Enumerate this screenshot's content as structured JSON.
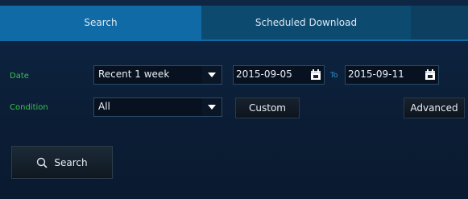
{
  "tabs": {
    "search": "Search",
    "scheduled": "Scheduled Download"
  },
  "date": {
    "label": "Date",
    "range_value": "Recent 1 week",
    "from": "2015-09-05",
    "to_label": "To",
    "to": "2015-09-11"
  },
  "condition": {
    "label": "Condition",
    "value": "All",
    "custom_label": "Custom",
    "advanced_label": "Advanced"
  },
  "search_button": {
    "label": "Search"
  },
  "colors": {
    "label_green": "#39c24a",
    "tab_active": "#0f6aa6",
    "tab_inactive": "#0c4a70"
  }
}
